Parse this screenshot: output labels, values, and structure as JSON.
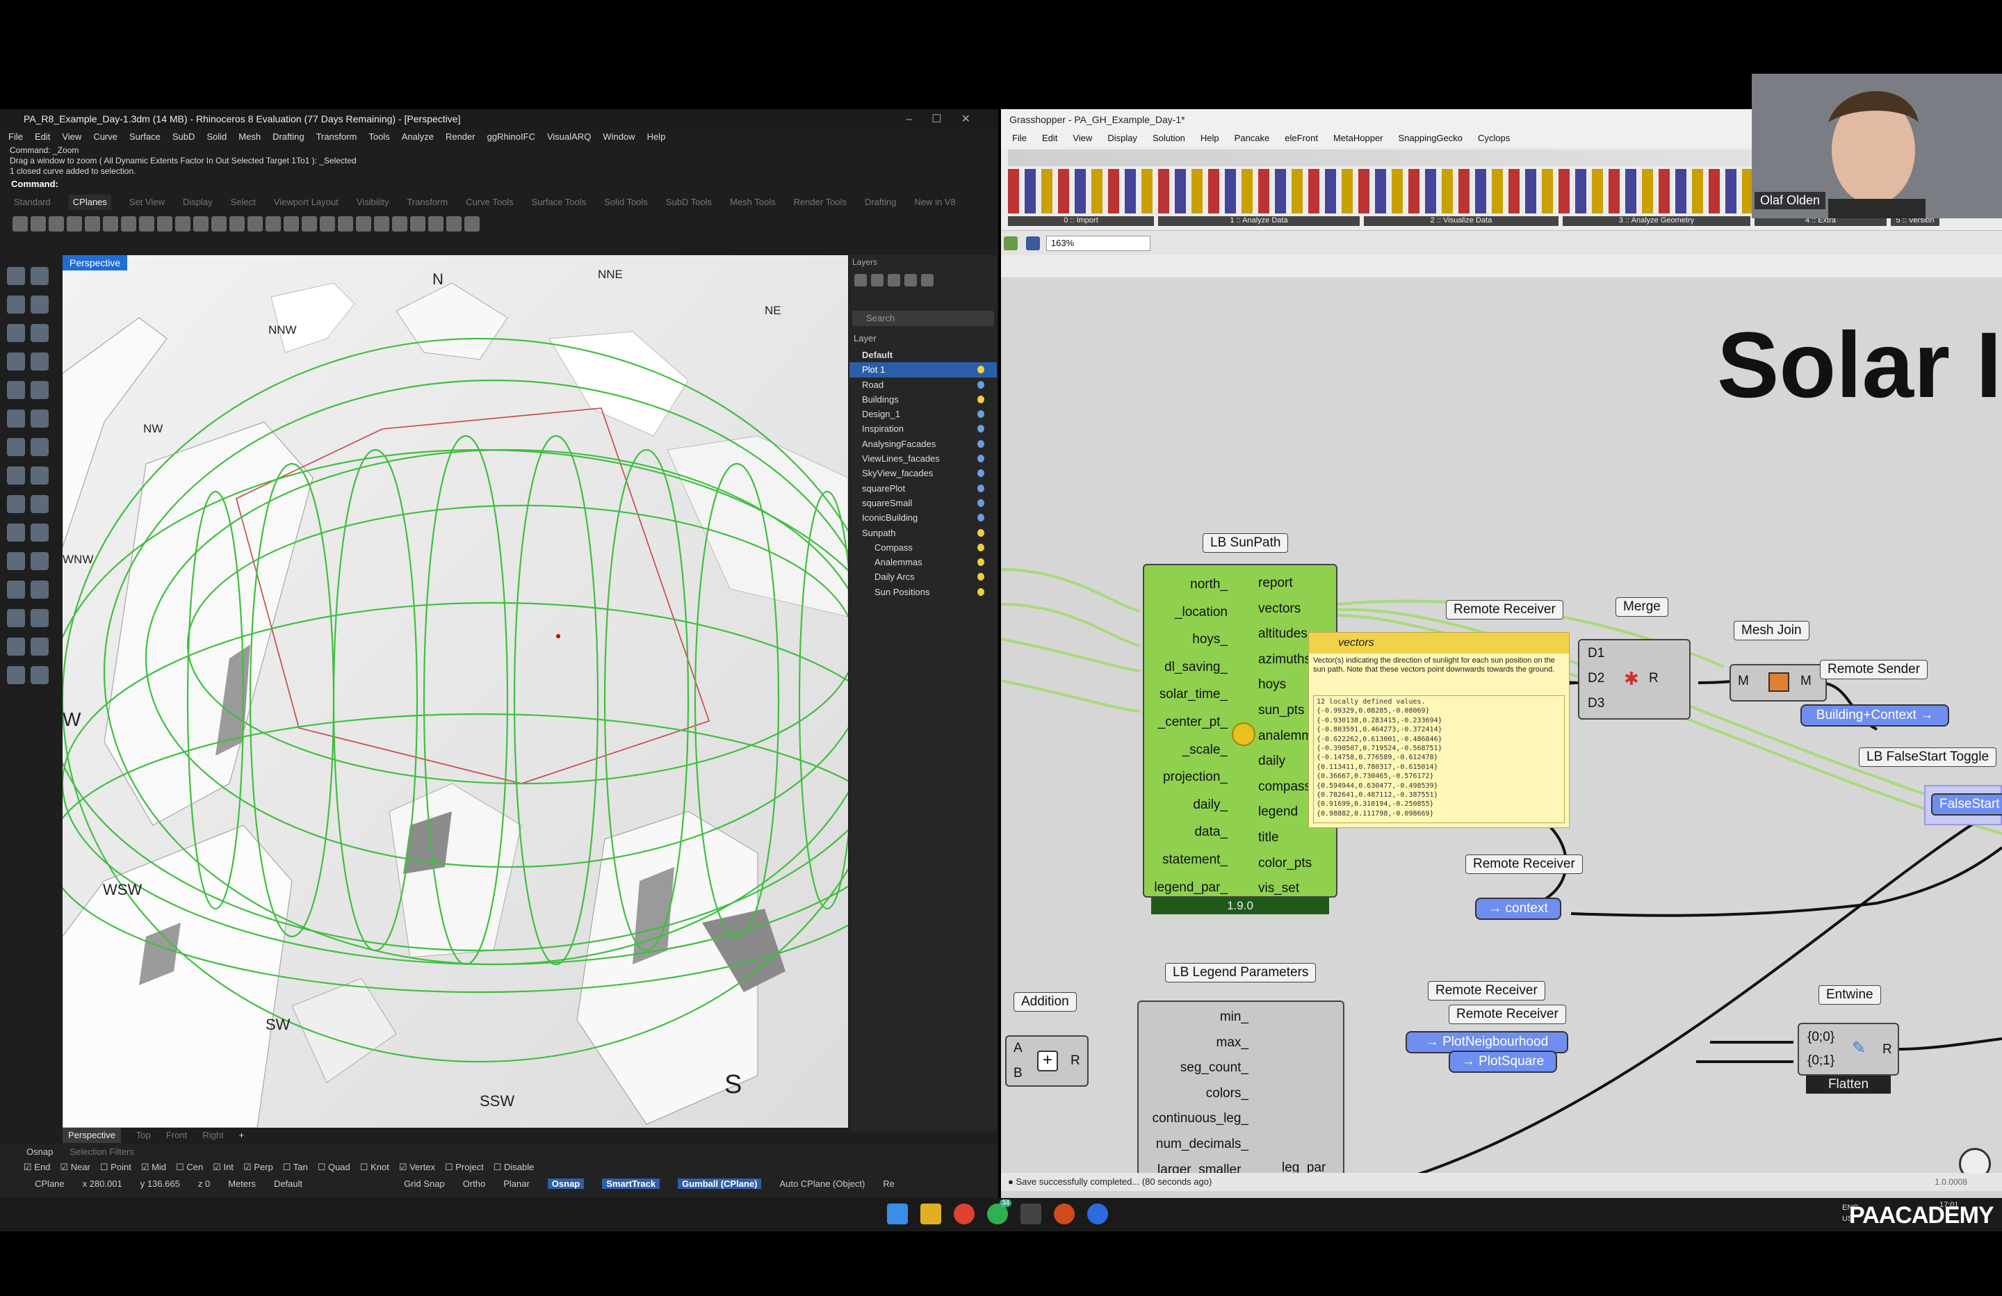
{
  "rhino": {
    "title": "PA_R8_Example_Day-1.3dm (14 MB) - Rhinoceros 8 Evaluation (77 Days Remaining) - [Perspective]",
    "menu": [
      "File",
      "Edit",
      "View",
      "Curve",
      "Surface",
      "SubD",
      "Solid",
      "Mesh",
      "Drafting",
      "Transform",
      "Tools",
      "Analyze",
      "Render",
      "ggRhinoIFC",
      "VisualARQ",
      "Window",
      "Help"
    ],
    "command_history": [
      "Command: _Zoom",
      "Drag a window to zoom ( All Dynamic Extents Factor In Out Selected Target 1To1 ): _Selected",
      "1 closed curve added to selection."
    ],
    "command_prompt": "Command:",
    "tabs": [
      "Standard",
      "CPlanes",
      "Set View",
      "Display",
      "Select",
      "Viewport Layout",
      "Visibility",
      "Transform",
      "Curve Tools",
      "Surface Tools",
      "Solid Tools",
      "SubD Tools",
      "Mesh Tools",
      "Render Tools",
      "Drafting",
      "New in V8"
    ],
    "viewport_label": "Perspective",
    "directions": [
      "N",
      "NNE",
      "NE",
      "NNW",
      "NW",
      "WNW",
      "W",
      "WSW",
      "SW",
      "SSW",
      "S"
    ],
    "layers_title": "Layers",
    "search_placeholder": "Search",
    "layer_header": "Layer",
    "layers": [
      "Default",
      "Plot 1",
      "Road",
      "Buildings",
      "Design_1",
      "Inspiration",
      "AnalysingFacades",
      "ViewLines_facades",
      "SkyView_facades",
      "squarePlot",
      "squareSmall",
      "IconicBuilding",
      "Sunpath",
      "Compass",
      "Analemmas",
      "Daily Arcs",
      "Sun Positions"
    ],
    "viewport_tabs": [
      "Perspective",
      "Top",
      "Front",
      "Right"
    ],
    "osnap_label": "Osnap",
    "selection_filters": "Selection Filters",
    "osnaps": [
      "End",
      "Near",
      "Point",
      "Mid",
      "Cen",
      "Int",
      "Perp",
      "Tan",
      "Quad",
      "Knot",
      "Vertex",
      "Project",
      "Disable"
    ],
    "status": {
      "cplane": "CPlane",
      "x": "x 280.001",
      "y": "y 136.665",
      "z": "z 0",
      "units": "Meters",
      "layer": "Default",
      "grid": "Grid Snap",
      "ortho": "Ortho",
      "planar": "Planar",
      "osnap": "Osnap",
      "smart": "SmartTrack",
      "gumball": "Gumball (CPlane)",
      "autocplane": "Auto CPlane (Object)",
      "rec": "Re"
    }
  },
  "gh": {
    "title": "Grasshopper - PA_GH_Example_Day-1*",
    "menu": [
      "File",
      "Edit",
      "View",
      "Display",
      "Solution",
      "Help",
      "Pancake",
      "eleFront",
      "MetaHopper",
      "SnappingGecko",
      "Cyclops"
    ],
    "ribbon_groups": [
      "0 :: Import",
      "1 :: Analyze Data",
      "2 :: Visualize Data",
      "3 :: Analyze Geometry",
      "4 :: Extra",
      "5 :: Version"
    ],
    "zoom": "163%",
    "solar_text": "Solar I",
    "sunpath": {
      "label": "LB SunPath",
      "inputs": [
        "north_",
        "_location",
        "hoys_",
        "dl_saving_",
        "solar_time_",
        "_center_pt_",
        "_scale_",
        "projection_",
        "daily_",
        "data_",
        "statement_",
        "legend_par_"
      ],
      "outputs": [
        "report",
        "vectors",
        "altitudes",
        "azimuths",
        "hoys",
        "sun_pts",
        "analemma",
        "daily",
        "compass",
        "legend",
        "title",
        "color_pts",
        "vis_set"
      ],
      "version": "1.9.0"
    },
    "tooltip": {
      "title": "vectors",
      "desc": "Vector(s) indicating the direction of sunlight for each sun position on the sun path. Note that these vectors point downwards towards the ground.",
      "values": [
        "12 locally defined values.",
        "{-0.99329,0.08285,-0.08069}",
        "{-0.930138,0.283415,-0.233694}",
        "{-0.803591,0.464273,-0.372414}",
        "{-0.622262,0.613001,-0.486846}",
        "{-0.398507,0.719524,-0.568751}",
        "{-0.14758,0.776589,-0.612478}",
        "{0.113411,0.780317,-0.615014}",
        "{0.36667,0.730465,-0.576172}",
        "{0.594944,0.630477,-0.498539}",
        "{0.782641,0.487112,-0.387551}",
        "{0.91699,0.310194,-0.250855}",
        "{0.98882,0.111798,-0.098669}"
      ]
    },
    "remote_receiver": "Remote Receiver",
    "merge": {
      "label": "Merge",
      "d1": "D1",
      "d2": "D2",
      "d3": "D3",
      "r": "R"
    },
    "mesh_join": {
      "label": "Mesh Join",
      "m": "M"
    },
    "remote_sender": "Remote Sender",
    "building_context": "Building+Context",
    "falsestart_toggle": "LB FalseStart Toggle",
    "falsestart": "FalseStart",
    "context": "context",
    "legend_params": {
      "label": "LB Legend Parameters",
      "inputs": [
        "min_",
        "max_",
        "seg_count_",
        "colors_",
        "continuous_leg_",
        "num_decimals_",
        "larger_smaller_"
      ],
      "out": "leg_par"
    },
    "addition": {
      "label": "Addition",
      "a": "A",
      "b": "B",
      "r": "R"
    },
    "plot_neighbourhood": "PlotNeigbourhood",
    "plot_square": "PlotSquare",
    "entwine": {
      "label": "Entwine",
      "p0": "{0;0}",
      "p1": "{0;1}",
      "r": "R"
    },
    "flatten": "Flatten",
    "status_msg": "Save successfully completed... (80 seconds ago)",
    "version_num": "1.0.0008"
  },
  "webcam_name": "Olaf Olden",
  "taskbar": {
    "lang": "ENG",
    "lang2": "US",
    "time": "17:01",
    "badge": "34"
  },
  "watermark": "PAACADEMY"
}
